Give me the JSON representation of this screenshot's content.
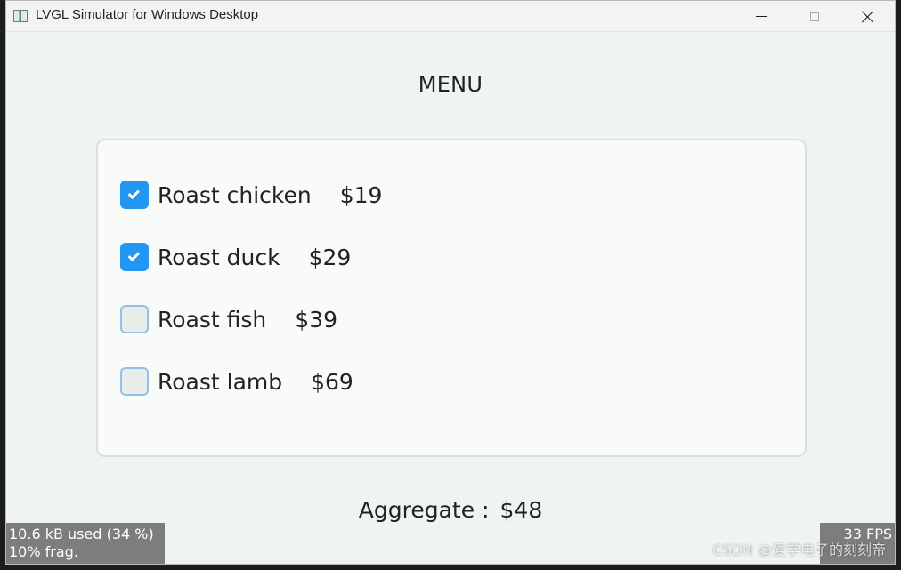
{
  "window": {
    "title": "LVGL Simulator for Windows Desktop",
    "controls": {
      "minimize_icon": "minimize-icon",
      "maximize_icon": "maximize-icon",
      "close_icon": "close-icon"
    }
  },
  "screen": {
    "title": "MENU",
    "items": [
      {
        "label": "Roast chicken",
        "price": "$19",
        "checked": true
      },
      {
        "label": "Roast duck",
        "price": "$29",
        "checked": true
      },
      {
        "label": "Roast fish",
        "price": "$39",
        "checked": false
      },
      {
        "label": "Roast lamb",
        "price": "$69",
        "checked": false
      }
    ],
    "aggregate": {
      "label": "Aggregate",
      "separator": ":",
      "value": "$48"
    }
  },
  "overlays": {
    "memory_used": "10.6 kB used (34 %)",
    "fragmentation": "10% frag.",
    "fps": "33 FPS"
  },
  "watermark": "CSDN @爱学电子的刻刻帝",
  "colors": {
    "accent": "#2196f3",
    "background": "#f0f4f1",
    "card": "#f8fbf8",
    "overlay": "#7d7d7d"
  }
}
